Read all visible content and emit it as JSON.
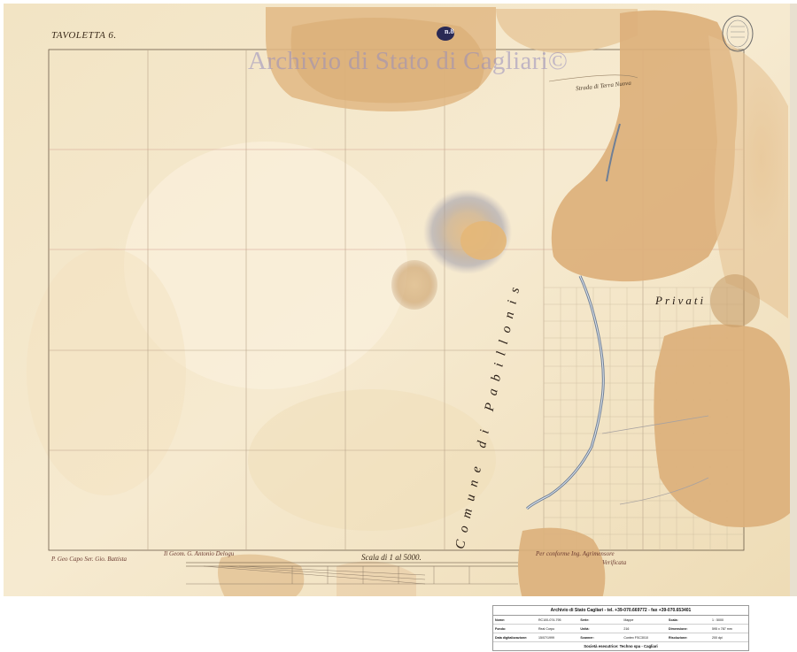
{
  "map": {
    "sheet_title": "TAVOLETTA 6.",
    "watermark": "Archivio di Stato di Cagliari©",
    "pencil_note": "n.8",
    "label_privati": "Privati",
    "label_comune": "Comune di Pabillonis",
    "road_label": "Strada di Terra Nuova",
    "scale_text": "Scala di 1 al 5000.",
    "signatures": [
      "P. Geo Capo Ser. Gio. Battista",
      "Il Geom. G. Antonio Delogu",
      "Per conforme Ing. Agrimensore",
      "Verificata"
    ]
  },
  "archive_info": {
    "header": "Archivio di Stato Cagliari - tel. +39-070.669772 - fax +39-070.653401",
    "rows": [
      {
        "k1": "Nome:",
        "v1": "RC100-074-795",
        "k2": "Serie:",
        "v2": "Mappe",
        "k3": "Scala:",
        "v3": "1 : 5000"
      },
      {
        "k1": "Fondo:",
        "v1": "Real Corpo",
        "k2": "Unità:",
        "v2": "216",
        "k3": "Dimensione:",
        "v3": "595 x 787 mm"
      },
      {
        "k1": "Data digitalizzazione:",
        "v1": "15/07/1999",
        "k2": "Scanner:",
        "v2": "Contex FSC3010",
        "k3": "Risoluzione:",
        "v3": "200 dpi"
      }
    ],
    "footer": "Società esecutrice: Techno spa - Cagliari"
  }
}
